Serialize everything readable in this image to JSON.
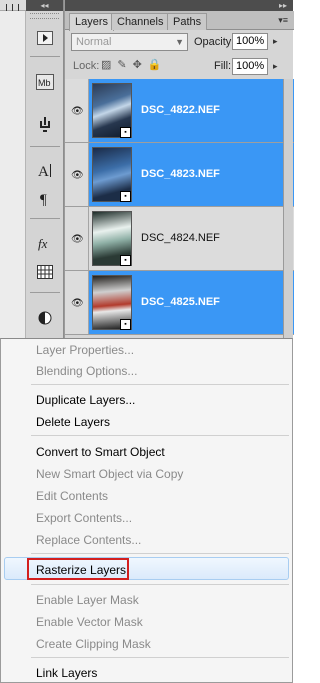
{
  "panel": {
    "collapse_glyph": "◂◂",
    "expand_glyph": "▸▸",
    "tabs": [
      "Layers",
      "Channels",
      "Paths"
    ],
    "menu_glyph": "▾≡",
    "blend_mode": "Normal",
    "opacity_label": "Opacity:",
    "opacity_value": "100%",
    "lock_label": "Lock:",
    "fill_label": "Fill:",
    "fill_value": "100%"
  },
  "layers": [
    {
      "name": "DSC_4822.NEF",
      "selected": true
    },
    {
      "name": "DSC_4823.NEF",
      "selected": true
    },
    {
      "name": "DSC_4824.NEF",
      "selected": false
    },
    {
      "name": "DSC_4825.NEF",
      "selected": true
    }
  ],
  "context_menu": {
    "groups": [
      [
        {
          "label": "Layer Properties...",
          "enabled": false
        },
        {
          "label": "Blending Options...",
          "enabled": false
        }
      ],
      [
        {
          "label": "Duplicate Layers...",
          "enabled": true
        },
        {
          "label": "Delete Layers",
          "enabled": true
        }
      ],
      [
        {
          "label": "Convert to Smart Object",
          "enabled": true
        },
        {
          "label": "New Smart Object via Copy",
          "enabled": false
        },
        {
          "label": "Edit Contents",
          "enabled": false
        },
        {
          "label": "Export Contents...",
          "enabled": false
        },
        {
          "label": "Replace Contents...",
          "enabled": false
        }
      ],
      [
        {
          "label": "Rasterize Layers",
          "enabled": true,
          "highlighted": true
        }
      ],
      [
        {
          "label": "Enable Layer Mask",
          "enabled": false
        },
        {
          "label": "Enable Vector Mask",
          "enabled": false
        },
        {
          "label": "Create Clipping Mask",
          "enabled": false
        }
      ],
      [
        {
          "label": "Link Layers",
          "enabled": true
        }
      ]
    ]
  },
  "colors": {
    "selection_blue": "#3a97f5",
    "highlight_border_red": "#d21f1f"
  }
}
